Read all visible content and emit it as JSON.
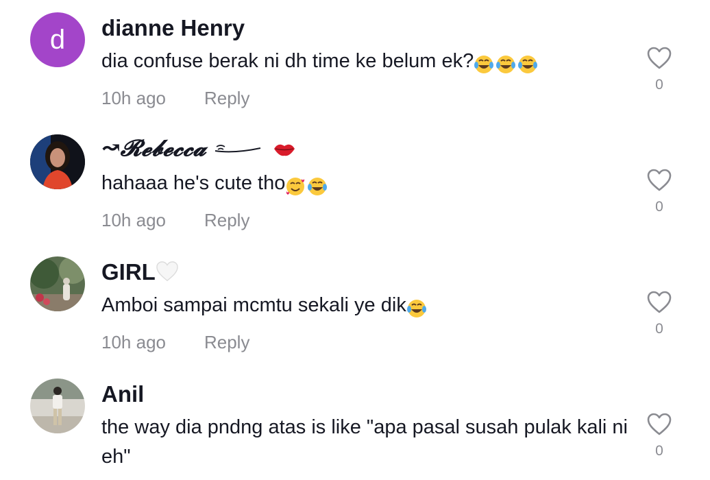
{
  "comments": [
    {
      "username": "dianne Henry",
      "avatar_letter": "d",
      "text": "dia confuse berak ni dh time ke belum ek?",
      "text_emojis": "😂😂😂",
      "time": "10h ago",
      "reply": "Reply",
      "likes": "0"
    },
    {
      "username": "↝𝓡𝓮𝓫𝓮𝓬𝓬𝓪",
      "username_emoji": "💋",
      "text": "hahaaa he's cute tho",
      "text_emojis": "🥰😂",
      "time": "10h ago",
      "reply": "Reply",
      "likes": "0"
    },
    {
      "username": "GIRL",
      "username_emoji": "🤍",
      "text": "Amboi sampai mcmtu sekali ye dik",
      "text_emojis": "😂",
      "time": "10h ago",
      "reply": "Reply",
      "likes": "0"
    },
    {
      "username": "Anil",
      "text": "the way dia pndng atas is like \"apa pasal susah pulak kali ni eh\"",
      "time": "",
      "reply": "",
      "likes": "0"
    }
  ],
  "colors": {
    "text": "#161823",
    "muted": "#8a8b91",
    "avatar_purple": "#a345c9"
  }
}
